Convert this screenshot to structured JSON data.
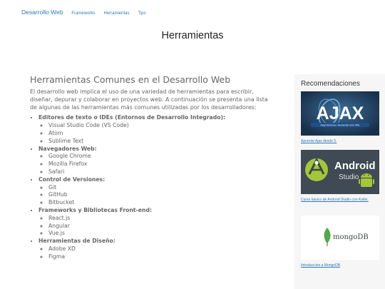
{
  "nav": {
    "brand": "Desarrollo Web",
    "links": [
      "Frameworks",
      "Herramientas",
      "Tips"
    ]
  },
  "page_title": "Herramientas",
  "main": {
    "heading": "Herramientas Comunes en el Desarrollo Web",
    "intro": "El desarrollo web implica el uso de una variedad de herramientas para escribir, diseñar, depurar y colaborar en proyectos web. A continuación se presenta una lista de algunas de las herramientas más comunes utilizadas por los desarrolladores:",
    "categories": [
      {
        "label": "Editores de texto o IDEs (Entornos de Desarrollo Integrado):",
        "tools": [
          "Visual Studio Code (VS Code)",
          "Atom",
          "Sublime Text"
        ]
      },
      {
        "label": "Navegadores Web:",
        "tools": [
          "Google Chrome",
          "Mozilla Firefox",
          "Safari"
        ]
      },
      {
        "label": "Control de Versiones:",
        "tools": [
          "Git",
          "GitHub",
          "Bitbucket"
        ]
      },
      {
        "label": "Frameworks y Bibliotecas Front-end:",
        "tools": [
          "React.js",
          "Angular",
          "Vue.js"
        ]
      },
      {
        "label": "Herramientas de Diseño:",
        "tools": [
          "Adobe XD",
          "Figma"
        ]
      }
    ]
  },
  "sidebar": {
    "title": "Recomendaciones",
    "items": [
      {
        "logo": "AJAX",
        "tagline": "Asynchronous Javascript and XML",
        "link": "Aprende Ajax desde 0."
      },
      {
        "logo": "Android",
        "logo_sub": "Studio",
        "link": "Curso basico de Android Studio con Kotlin."
      },
      {
        "logo": "mongoDB",
        "link": "Introduccion a MongoDB"
      }
    ]
  },
  "colors": {
    "link": "#2f7ab8",
    "ajax_bg": "#1e3a56",
    "android_bg": "#3f4a54",
    "mongo_green": "#4fa94d",
    "android_green": "#a4c639"
  }
}
